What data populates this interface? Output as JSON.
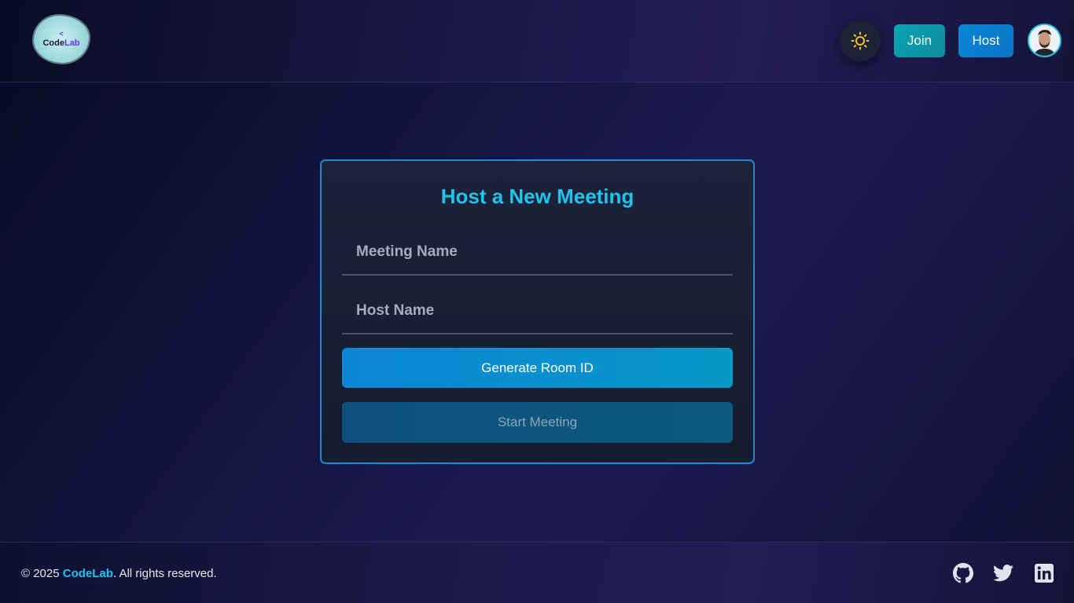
{
  "header": {
    "logo": {
      "mark": "<",
      "text_main": "Code",
      "text_accent": "Lab"
    },
    "theme_icon": "sun-icon",
    "join_label": "Join",
    "host_label": "Host",
    "avatar_icon": "user-avatar"
  },
  "card": {
    "title": "Host a New Meeting",
    "meeting_name": {
      "placeholder": "Meeting Name",
      "value": ""
    },
    "host_name": {
      "placeholder": "Host Name",
      "value": ""
    },
    "generate_label": "Generate Room ID",
    "start_label": "Start Meeting"
  },
  "footer": {
    "copyright_prefix": "© 2025 ",
    "brand": "CodeLab",
    "copyright_suffix": ". All rights reserved.",
    "social": [
      "github-icon",
      "twitter-icon",
      "linkedin-icon"
    ]
  },
  "colors": {
    "accent": "#1ec4ee",
    "join": "#0aa4b3",
    "host": "#0a86d8",
    "card_border": "#1e88d8",
    "sun": "#f5c518"
  }
}
